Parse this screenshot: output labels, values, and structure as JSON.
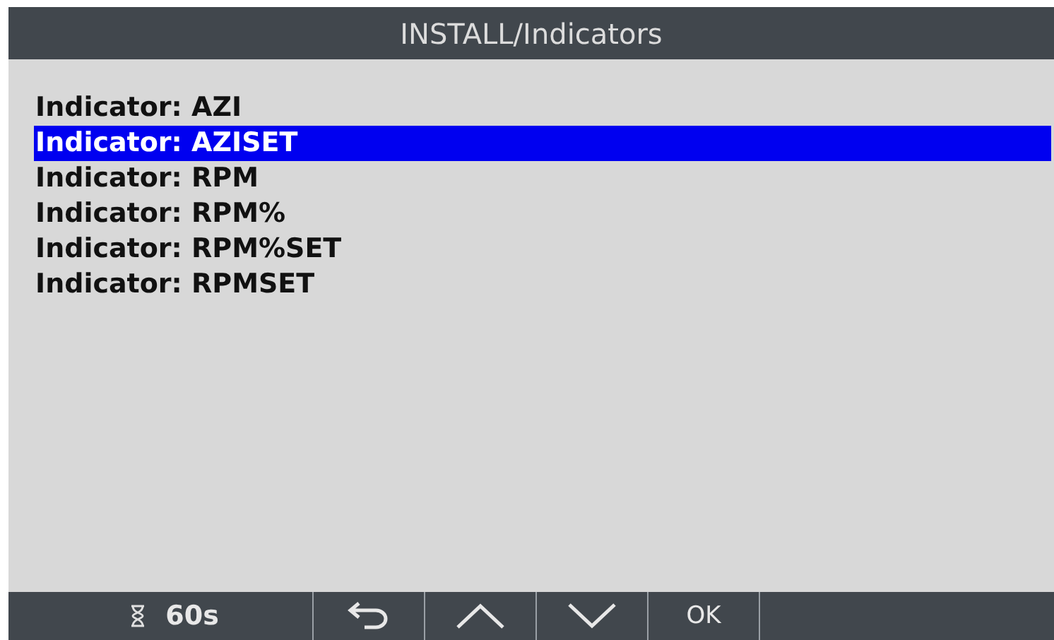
{
  "window": {
    "title": "INSTALL/Indicators"
  },
  "items": [
    {
      "label": "Indicator: AZI",
      "selected": false
    },
    {
      "label": "Indicator: AZISET",
      "selected": true
    },
    {
      "label": "Indicator: RPM",
      "selected": false
    },
    {
      "label": "Indicator: RPM%",
      "selected": false
    },
    {
      "label": "Indicator: RPM%SET",
      "selected": false
    },
    {
      "label": "Indicator: RPMSET",
      "selected": false
    }
  ],
  "bottom_bar": {
    "timer": "60s",
    "ok": "OK"
  }
}
